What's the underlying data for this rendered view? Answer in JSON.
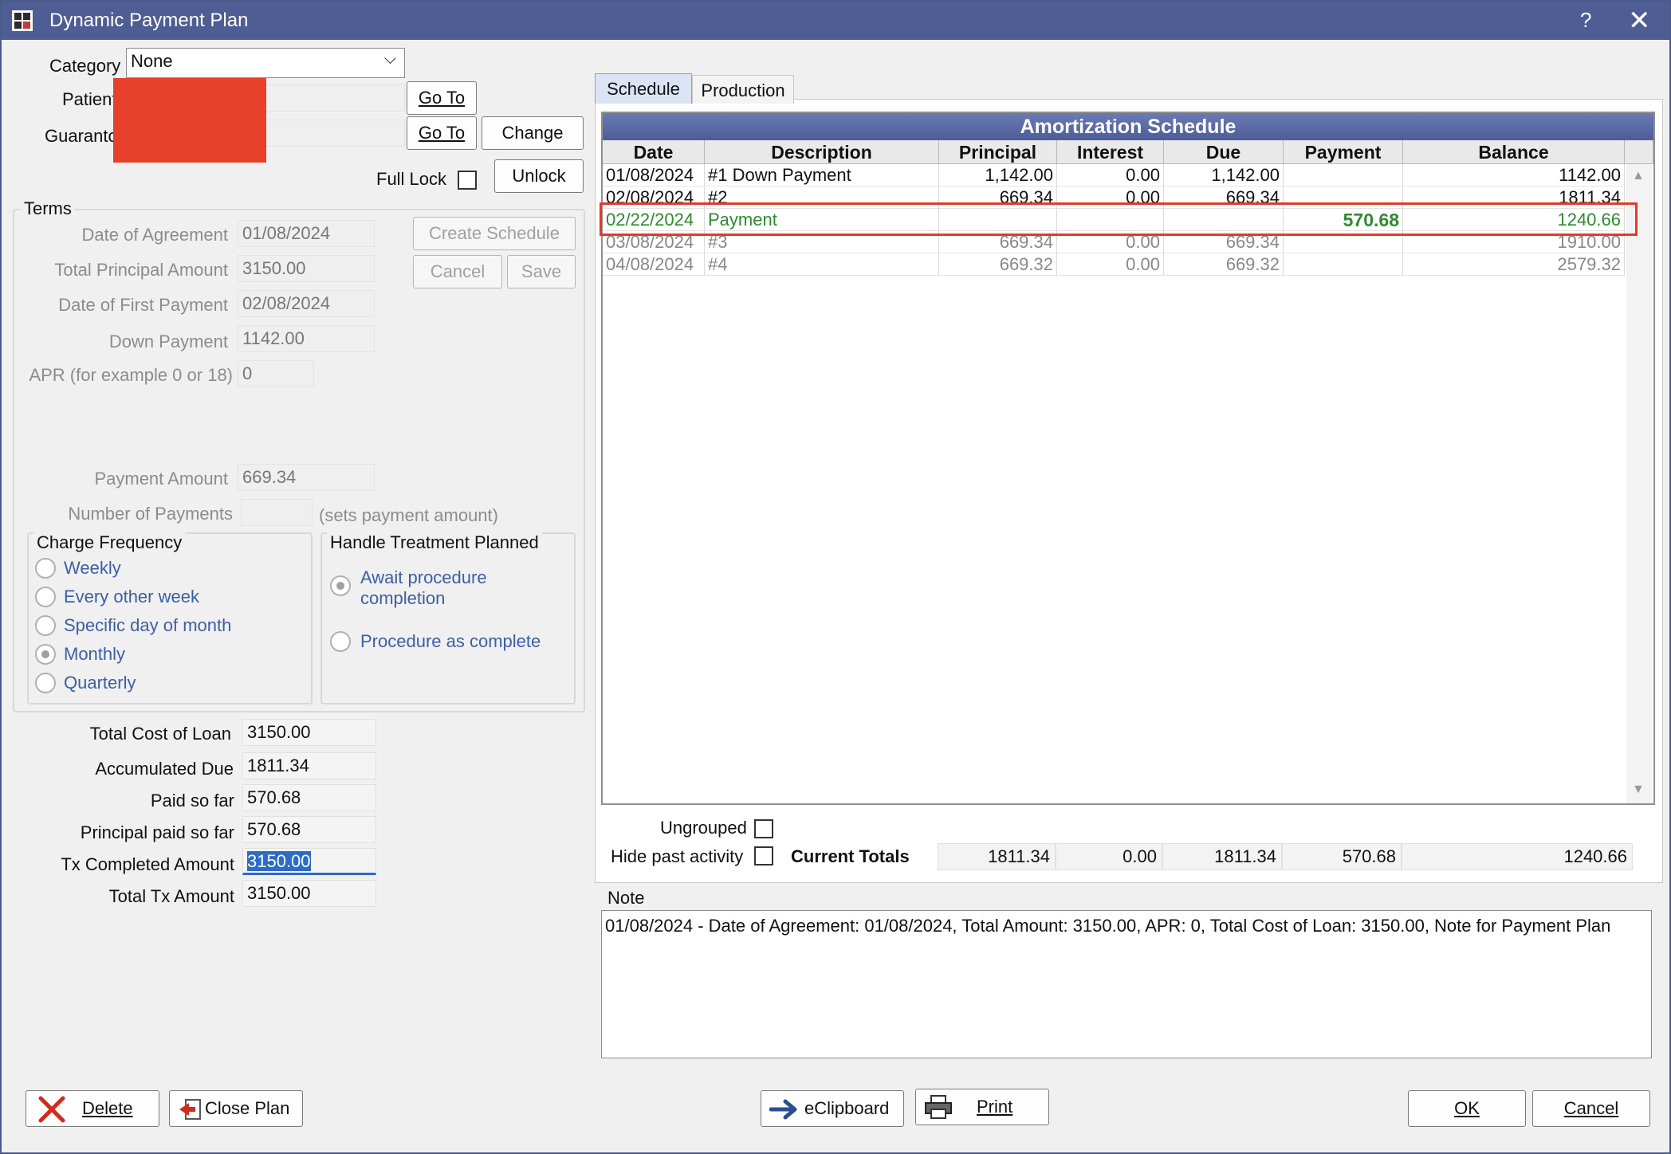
{
  "window": {
    "title": "Dynamic Payment Plan",
    "help": "?",
    "close": "✕"
  },
  "header": {
    "category_label": "Category",
    "category_value": "None",
    "patient_label": "Patient",
    "guarantor_label": "Guaranto",
    "goto1": "Go To",
    "goto2": "Go To",
    "change": "Change",
    "full_lock_label": "Full Lock",
    "unlock": "Unlock"
  },
  "terms": {
    "title": "Terms",
    "date_agreement_label": "Date of Agreement",
    "date_agreement": "01/08/2024",
    "total_principal_label": "Total Principal Amount",
    "total_principal": "3150.00",
    "first_payment_label": "Date of First Payment",
    "first_payment": "02/08/2024",
    "down_payment_label": "Down Payment",
    "down_payment": "1142.00",
    "apr_label": "APR (for example 0 or 18)",
    "apr": "0",
    "payment_amount_label": "Payment Amount",
    "payment_amount": "669.34",
    "num_payments_label": "Number of Payments",
    "num_payments_hint": "(sets payment amount)",
    "create_schedule": "Create Schedule",
    "cancel": "Cancel",
    "save": "Save"
  },
  "charge_frequency": {
    "title": "Charge Frequency",
    "options": [
      "Weekly",
      "Every other week",
      "Specific day of month",
      "Monthly",
      "Quarterly"
    ],
    "selected": "Monthly"
  },
  "treatment": {
    "title": "Handle Treatment Planned",
    "option1": "Await procedure completion",
    "option1_line1": "Await procedure",
    "option1_line2": "completion",
    "option2": "Procedure as complete",
    "selected": "Await procedure completion"
  },
  "summary": {
    "total_cost_label": "Total Cost of Loan",
    "total_cost": "3150.00",
    "accum_due_label": "Accumulated Due",
    "accum_due": "1811.34",
    "paid_label": "Paid so far",
    "paid": "570.68",
    "principal_paid_label": "Principal paid so far",
    "principal_paid": "570.68",
    "tx_completed_label": "Tx Completed Amount",
    "tx_completed": "3150.00",
    "total_tx_label": "Total Tx Amount",
    "total_tx": "3150.00"
  },
  "tabs": [
    "Schedule",
    "Production"
  ],
  "schedule": {
    "title": "Amortization Schedule",
    "columns": [
      "Date",
      "Description",
      "Principal",
      "Interest",
      "Due",
      "Payment",
      "Balance"
    ],
    "rows": [
      [
        "01/08/2024",
        "#1 Down Payment",
        "1,142.00",
        "0.00",
        "1,142.00",
        "",
        "1142.00"
      ],
      [
        "02/08/2024",
        "#2",
        "669.34",
        "0.00",
        "669.34",
        "",
        "1811.34"
      ],
      [
        "02/22/2024",
        "Payment",
        "",
        "",
        "",
        "570.68",
        "1240.66"
      ],
      [
        "03/08/2024",
        "#3",
        "669.34",
        "0.00",
        "669.34",
        "",
        "1910.00"
      ],
      [
        "04/08/2024",
        "#4",
        "669.32",
        "0.00",
        "669.32",
        "",
        "2579.32"
      ]
    ],
    "row_colors": [
      "#111111",
      "#111111",
      "#2e8b2e",
      "#888888",
      "#888888"
    ]
  },
  "footer_grid": {
    "ungrouped_label": "Ungrouped",
    "hide_past_label": "Hide past activity",
    "totals_label": "Current Totals",
    "totals": [
      "1811.34",
      "0.00",
      "1811.34",
      "570.68",
      "1240.66"
    ]
  },
  "note": {
    "label": "Note",
    "text": "01/08/2024 - Date of Agreement: 01/08/2024, Total Amount: 3150.00, APR: 0, Total Cost of Loan: 3150.00, Note for Payment Plan"
  },
  "buttons": {
    "delete": "Delete",
    "close_plan": "Close Plan",
    "eclipboard": "eClipboard",
    "print": "Print",
    "ok": "OK",
    "cancel": "Cancel"
  },
  "colors": {
    "title_bar": "#4e5d93",
    "highlight": "#e23a2f",
    "payment_green": "#2e8b2e",
    "redaction": "#e8412b"
  }
}
